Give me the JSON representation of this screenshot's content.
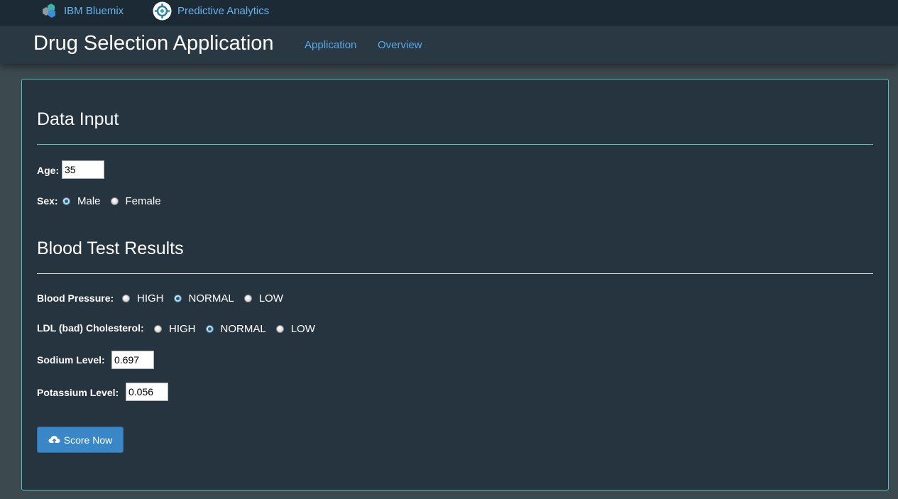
{
  "topbar": {
    "bluemix_label": "IBM Bluemix",
    "bluemix_icon": "bluemix-logo-icon",
    "pa_label": "Predictive Analytics",
    "pa_icon": "predictive-analytics-icon"
  },
  "header": {
    "title": "Drug Selection Application",
    "nav": [
      "Application",
      "Overview"
    ]
  },
  "data_input": {
    "heading": "Data Input",
    "age_label": "Age:",
    "age_value": "35",
    "sex_label": "Sex:",
    "sex_options": [
      "Male",
      "Female"
    ],
    "sex_selected": "Male"
  },
  "blood_test": {
    "heading": "Blood Test Results",
    "bp_label": "Blood Pressure:",
    "bp_options": [
      "HIGH",
      "NORMAL",
      "LOW"
    ],
    "bp_selected": "NORMAL",
    "ldl_label": "LDL (bad) Cholesterol:",
    "ldl_options": [
      "HIGH",
      "NORMAL",
      "LOW"
    ],
    "ldl_selected": "NORMAL",
    "sodium_label": "Sodium Level:",
    "sodium_value": "0.697",
    "potassium_label": "Potassium Level:",
    "potassium_value": "0.056"
  },
  "score_button": {
    "label": "Score Now",
    "icon": "cloud-upload-icon"
  },
  "colors": {
    "topbar_bg": "#1b2a35",
    "header_bg": "#2a3843",
    "panel_bg": "#263440",
    "panel_border": "#4fc3b2",
    "link": "#5aa9e6",
    "button": "#3a87c8"
  }
}
